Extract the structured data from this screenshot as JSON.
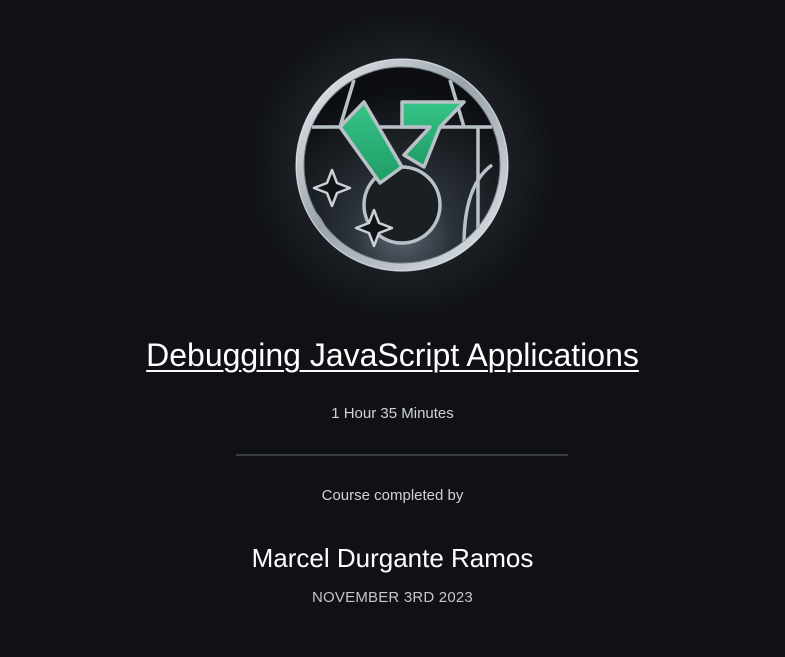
{
  "badge": {
    "icon": "medal-badge-icon",
    "colors": {
      "ribbon": "#2fb37a",
      "ring": "#c9d0d6",
      "background": "#0f1115"
    }
  },
  "course": {
    "title": "Debugging JavaScript Applications",
    "duration": "1 Hour 35 Minutes"
  },
  "completion": {
    "label": "Course completed by",
    "learner_name": "Marcel Durgante Ramos",
    "date": "NOVEMBER 3RD 2023"
  }
}
